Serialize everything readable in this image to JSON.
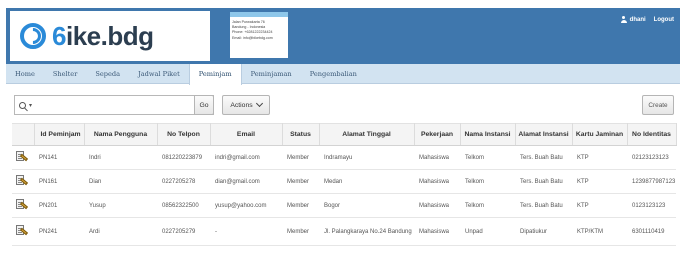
{
  "header": {
    "logo": {
      "a": "6",
      "b": "ike.bdg"
    },
    "address": [
      "Jalan Purwakarta 76",
      "Bandung - Indonesia",
      "Phone: +6281222234424",
      "Email: info@bikebdg.com"
    ],
    "username": "dhani",
    "logout_label": "Logout"
  },
  "tabs": [
    {
      "label": "Home",
      "active": false
    },
    {
      "label": "Shelter",
      "active": false
    },
    {
      "label": "Sepeda",
      "active": false
    },
    {
      "label": "Jadwal Piket",
      "active": false
    },
    {
      "label": "Peminjam",
      "active": true
    },
    {
      "label": "Peminjaman",
      "active": false
    },
    {
      "label": "Pengembalian",
      "active": false
    }
  ],
  "toolbar": {
    "search_value": "",
    "go_label": "Go",
    "actions_label": "Actions",
    "create_label": "Create"
  },
  "table": {
    "columns": [
      "Id Peminjam",
      "Nama Pengguna",
      "No Telpon",
      "Email",
      "Status",
      "Alamat Tinggal",
      "Pekerjaan",
      "Nama Instansi",
      "Alamat Instansi",
      "Kartu Jaminan",
      "No Identitas"
    ],
    "rows": [
      [
        "PN141",
        "Indri",
        "081220223879",
        "indri@gmail.com",
        "Member",
        "Indramayu",
        "Mahasiswa",
        "Telkom",
        "Ters. Buah Batu",
        "KTP",
        "02123123123"
      ],
      [
        "PN161",
        "Dian",
        "0227205278",
        "dian@gmail.com",
        "Member",
        "Medan",
        "Mahasiswa",
        "Telkom",
        "Ters. Buah Batu",
        "KTP",
        "1239877987123"
      ],
      [
        "PN201",
        "Yusup",
        "08562322500",
        "yusup@yahoo.com",
        "Member",
        "Bogor",
        "Mahasiswa",
        "Telkom",
        "Ters. Buah Batu",
        "KTP",
        "0123123123"
      ],
      [
        "PN241",
        "Ardi",
        "0227205279",
        "-",
        "Member",
        "Jl. Palangkaraya No.24 Bandung",
        "Mahasiswa",
        "Unpad",
        "Dipatiukur",
        "KTP/KTM",
        "6301110419"
      ]
    ]
  }
}
